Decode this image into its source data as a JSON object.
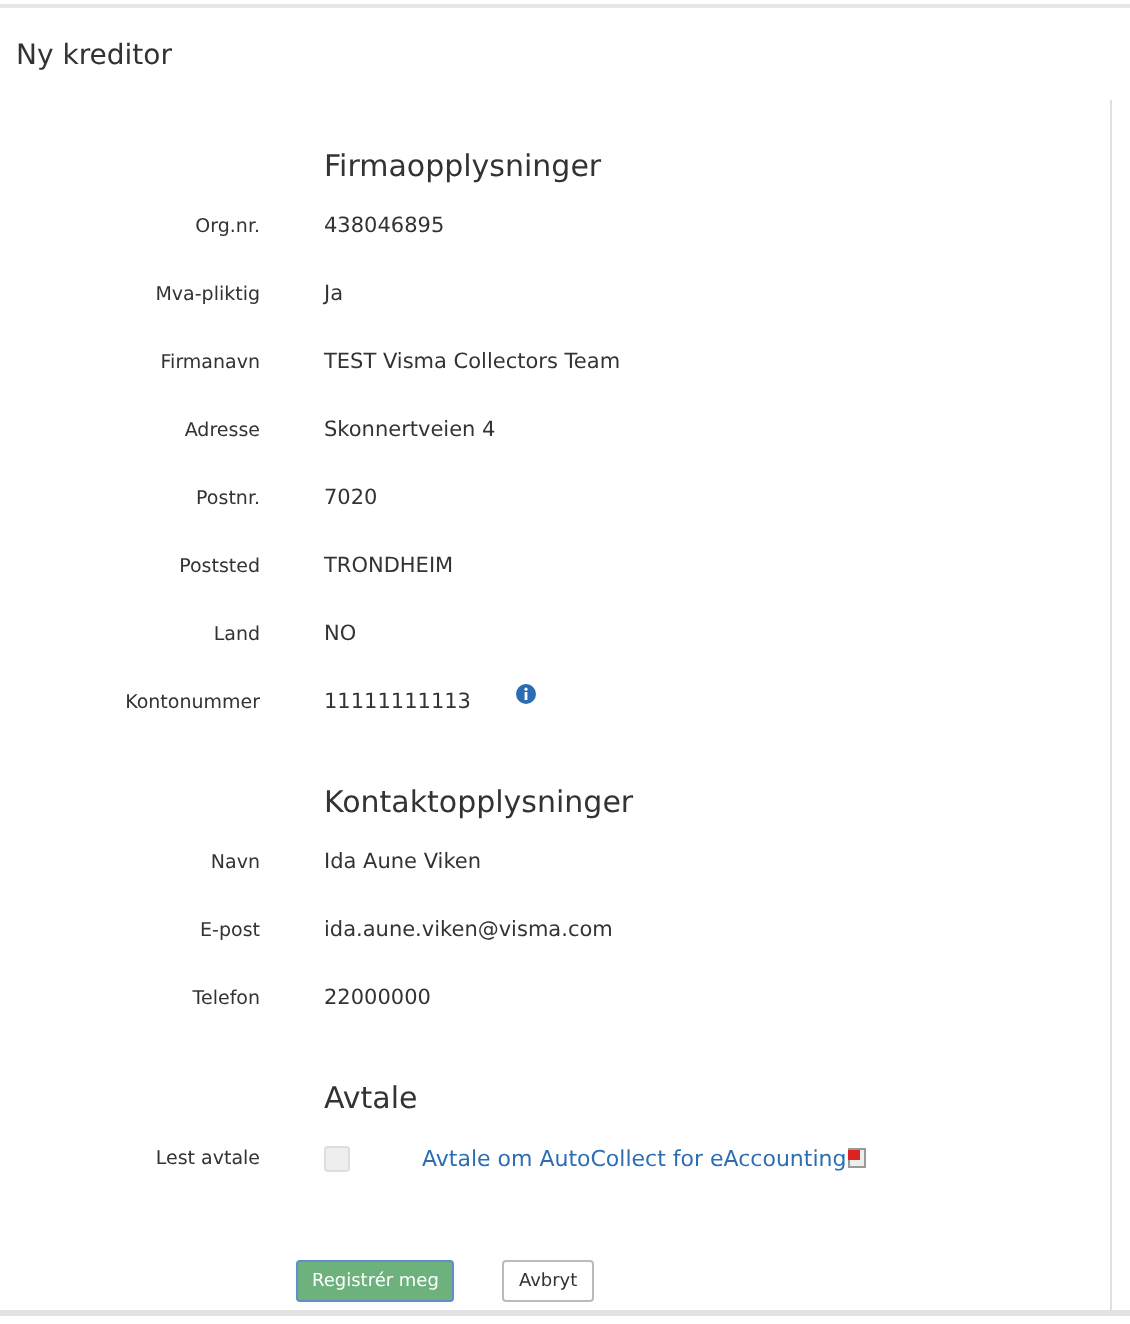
{
  "title": "Ny kreditor",
  "sections": [
    {
      "heading": "Firmaopplysninger",
      "rows": [
        {
          "label": "Org.nr.",
          "value": "438046895"
        },
        {
          "label": "Mva-pliktig",
          "value": "Ja"
        },
        {
          "label": "Firmanavn",
          "value": "TEST Visma Collectors Team"
        },
        {
          "label": "Adresse",
          "value": "Skonnertveien 4"
        },
        {
          "label": "Postnr.",
          "value": "7020"
        },
        {
          "label": "Poststed",
          "value": "TRONDHEIM"
        },
        {
          "label": "Land",
          "value": "NO"
        },
        {
          "label": "Kontonummer",
          "value": "11111111113",
          "info": true
        }
      ]
    },
    {
      "heading": "Kontaktopplysninger",
      "rows": [
        {
          "label": "Navn",
          "value": "Ida Aune Viken"
        },
        {
          "label": "E-post",
          "value": "ida.aune.viken@visma.com"
        },
        {
          "label": "Telefon",
          "value": "22000000"
        }
      ]
    },
    {
      "heading": "Avtale"
    }
  ],
  "agreement": {
    "label": "Lest avtale",
    "checked": false,
    "link": "Avtale om AutoCollect for eAccounting"
  },
  "buttons": [
    {
      "label": "Registrér meg",
      "kind": "primary"
    },
    {
      "label": "Avbryt",
      "kind": "secondary"
    }
  ]
}
